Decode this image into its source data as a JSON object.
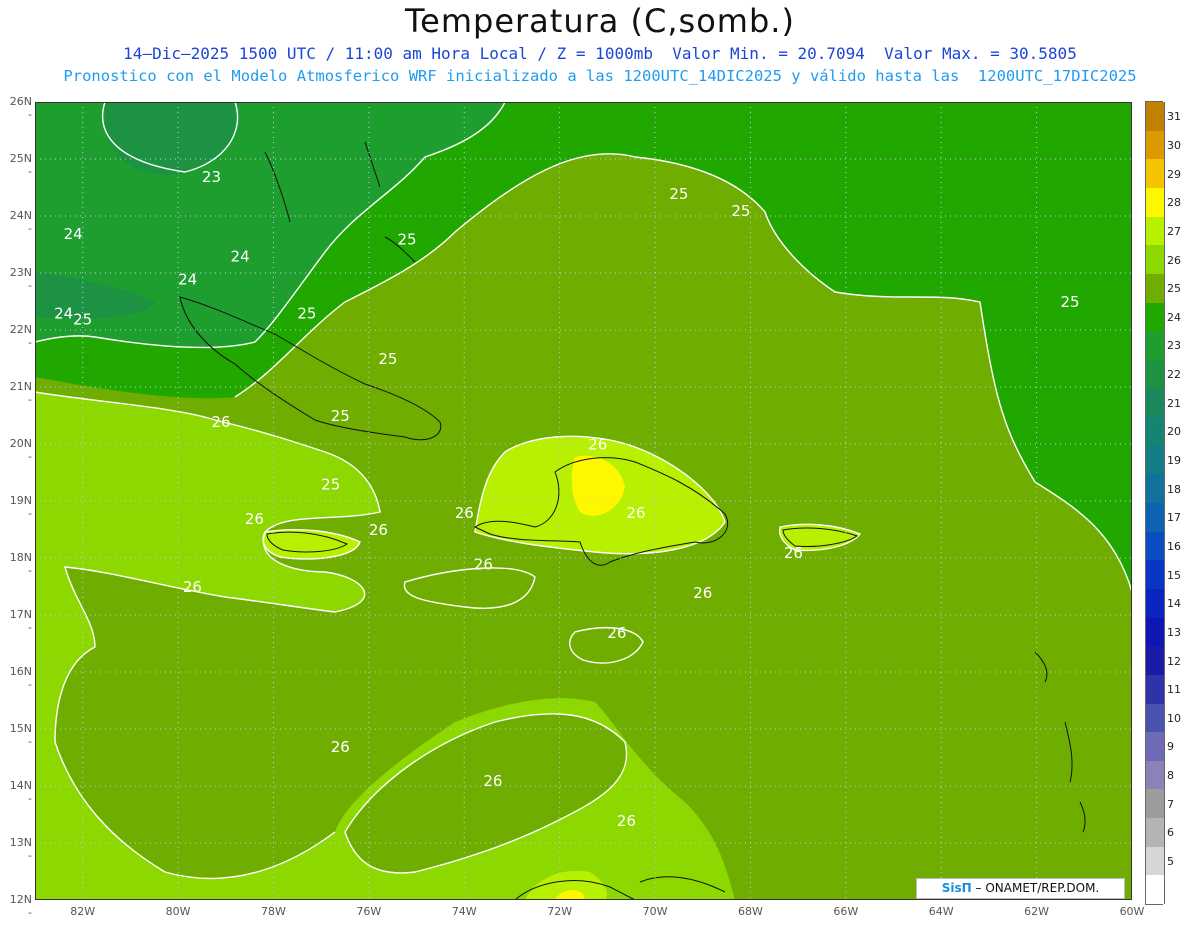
{
  "title": "Temperatura (C,somb.)",
  "subtitle_line1": "14–Dic–2025 1500 UTC / 11:00 am Hora Local / Z = 1000mb  Valor Min. = 20.7094  Valor Max. = 30.5805",
  "subtitle_line2": "Pronostico con el Modelo Atmosferico WRF inicializado a las 1200UTC_14DIC2025 y válido hasta las  1200UTC_17DIC2025",
  "map": {
    "lon_range": [
      -83,
      -60
    ],
    "lat_range": [
      12,
      26
    ],
    "lat_ticks": [
      "26N",
      "25N",
      "24N",
      "23N",
      "22N",
      "21N",
      "20N",
      "19N",
      "18N",
      "17N",
      "16N",
      "15N",
      "14N",
      "13N",
      "12N"
    ],
    "lon_ticks": [
      "82W",
      "80W",
      "78W",
      "76W",
      "74W",
      "72W",
      "70W",
      "68W",
      "66W",
      "64W",
      "62W",
      "60W"
    ],
    "contour_labels": [
      {
        "text": "23",
        "lon": -79.3,
        "lat": 24.6
      },
      {
        "text": "24",
        "lon": -82.2,
        "lat": 23.6
      },
      {
        "text": "24",
        "lon": -78.7,
        "lat": 23.2
      },
      {
        "text": "24",
        "lon": -79.8,
        "lat": 22.8
      },
      {
        "text": "24",
        "lon": -82.4,
        "lat": 22.2
      },
      {
        "text": "25",
        "lon": -82.0,
        "lat": 22.1
      },
      {
        "text": "25",
        "lon": -75.2,
        "lat": 23.5
      },
      {
        "text": "25",
        "lon": -69.5,
        "lat": 24.3
      },
      {
        "text": "25",
        "lon": -68.2,
        "lat": 24.0
      },
      {
        "text": "25",
        "lon": -61.3,
        "lat": 22.4
      },
      {
        "text": "25",
        "lon": -77.3,
        "lat": 22.2
      },
      {
        "text": "25",
        "lon": -75.6,
        "lat": 21.4
      },
      {
        "text": "25",
        "lon": -76.6,
        "lat": 20.4
      },
      {
        "text": "25",
        "lon": -76.8,
        "lat": 19.2
      },
      {
        "text": "26",
        "lon": -79.1,
        "lat": 20.3
      },
      {
        "text": "26",
        "lon": -78.4,
        "lat": 18.6
      },
      {
        "text": "26",
        "lon": -75.8,
        "lat": 18.4
      },
      {
        "text": "26",
        "lon": -74.0,
        "lat": 18.7
      },
      {
        "text": "26",
        "lon": -71.2,
        "lat": 19.9
      },
      {
        "text": "26",
        "lon": -70.4,
        "lat": 18.7
      },
      {
        "text": "26",
        "lon": -67.1,
        "lat": 18.0
      },
      {
        "text": "26",
        "lon": -73.6,
        "lat": 17.8
      },
      {
        "text": "26",
        "lon": -69.0,
        "lat": 17.3
      },
      {
        "text": "26",
        "lon": -70.8,
        "lat": 16.6
      },
      {
        "text": "26",
        "lon": -79.7,
        "lat": 17.4
      },
      {
        "text": "26",
        "lon": -76.6,
        "lat": 14.6
      },
      {
        "text": "26",
        "lon": -73.4,
        "lat": 14.0
      },
      {
        "text": "26",
        "lon": -70.6,
        "lat": 13.3
      }
    ]
  },
  "legend": {
    "labels": [
      "31",
      "30",
      "29",
      "28",
      "27",
      "26",
      "25",
      "24",
      "23",
      "22",
      "21",
      "20",
      "19",
      "18",
      "17",
      "16",
      "15",
      "14",
      "13",
      "12",
      "11",
      "10",
      "9",
      "8",
      "7",
      "6",
      "5"
    ],
    "colors": [
      "#c08000",
      "#dc9a00",
      "#f5c400",
      "#fff700",
      "#b7f000",
      "#8cd800",
      "#6fae00",
      "#21a800",
      "#1d9e2f",
      "#1c9242",
      "#1a8a5c",
      "#168473",
      "#137c88",
      "#11739c",
      "#0e62b2",
      "#0a4dc2",
      "#0a36c8",
      "#0a24c2",
      "#0e17b4",
      "#1a1aa6",
      "#2e34a8",
      "#4a54ae",
      "#6e6ab6",
      "#8c82b8",
      "#9c9c9c",
      "#b4b4b4",
      "#d6d6d6",
      "#ffffff"
    ]
  },
  "credit": {
    "brand": "SisΠ",
    "text": "– ONAMET/REP.DOM."
  }
}
